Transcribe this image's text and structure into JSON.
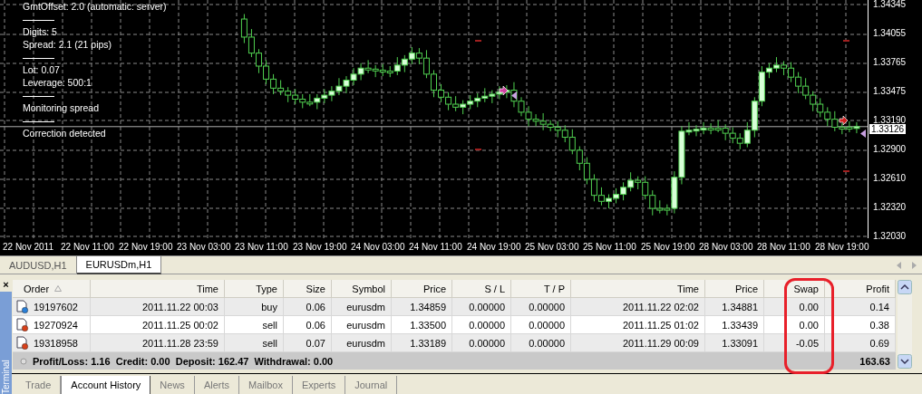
{
  "chart": {
    "info_lines": [
      {
        "kind": "text",
        "text": "GmtOffset: 2.0 (automatic: server)"
      },
      {
        "kind": "rule"
      },
      {
        "kind": "text",
        "text": "Digits:  5"
      },
      {
        "kind": "text",
        "text": "Spread: 2.1 (21 pips)"
      },
      {
        "kind": "rule"
      },
      {
        "kind": "text",
        "text": "Lot: 0.07"
      },
      {
        "kind": "text",
        "text": "Leverage: 500:1"
      },
      {
        "kind": "rule"
      },
      {
        "kind": "text",
        "text": "Monitoring spread"
      },
      {
        "kind": "rule"
      },
      {
        "kind": "text",
        "text": "Correction detected"
      }
    ],
    "current_price": "1.33126",
    "chart_data": {
      "type": "candlestick",
      "ylim": [
        1.3203,
        1.34345
      ],
      "grid": true,
      "ref_lines": [
        {
          "axis": "y",
          "value": 1.33126
        }
      ],
      "yticks": [
        {
          "value": 1.34345,
          "label": "1.34345"
        },
        {
          "value": 1.34055,
          "label": "1.34055"
        },
        {
          "value": 1.33765,
          "label": "1.33765"
        },
        {
          "value": 1.33475,
          "label": "1.33475"
        },
        {
          "value": 1.3319,
          "label": "1.33190"
        },
        {
          "value": 1.329,
          "label": "1.32900"
        },
        {
          "value": 1.3261,
          "label": "1.32610"
        },
        {
          "value": 1.3232,
          "label": "1.32320"
        },
        {
          "value": 1.3203,
          "label": "1.32030"
        }
      ],
      "categories": [
        null,
        null,
        null,
        null,
        null,
        null,
        null,
        null,
        null,
        null,
        null,
        null,
        null,
        null,
        null,
        null,
        null,
        null,
        null,
        null,
        null,
        null,
        null,
        null,
        null,
        null,
        null,
        null,
        null,
        null,
        null,
        null,
        null,
        null,
        null,
        null,
        null,
        null,
        null,
        null,
        null,
        null,
        null,
        null,
        null,
        null,
        null,
        null,
        null,
        null,
        null,
        null,
        null,
        null,
        null,
        null,
        null,
        null,
        null,
        null,
        null,
        null,
        null,
        null,
        null,
        null,
        null,
        null,
        null,
        null,
        null,
        null,
        null,
        null,
        null,
        null,
        null,
        null,
        null,
        null,
        null,
        null,
        null,
        null,
        null,
        null,
        null,
        null,
        null,
        null,
        null,
        null,
        null,
        null,
        null,
        null,
        null,
        null,
        null,
        null,
        null,
        null,
        null,
        null,
        null,
        null,
        null,
        null,
        null,
        null,
        null,
        null,
        null,
        null,
        null,
        null,
        null,
        null,
        null
      ],
      "ohlc": [
        null,
        null,
        null,
        null,
        null,
        null,
        null,
        null,
        null,
        null,
        null,
        null,
        null,
        null,
        null,
        null,
        null,
        null,
        null,
        null,
        null,
        null,
        null,
        null,
        null,
        null,
        null,
        null,
        null,
        null,
        null,
        null,
        null,
        [
          1.342,
          1.3425,
          1.3396,
          1.3402
        ],
        [
          1.3402,
          1.341,
          1.3382,
          1.3386
        ],
        [
          1.3386,
          1.339,
          1.3366,
          1.3373
        ],
        [
          1.3373,
          1.3379,
          1.3355,
          1.336
        ],
        [
          1.336,
          1.3365,
          1.3345,
          1.3351
        ],
        [
          1.3351,
          1.3359,
          1.3344,
          1.3348
        ],
        [
          1.3348,
          1.3352,
          1.3337,
          1.3344
        ],
        [
          1.3344,
          1.335,
          1.3335,
          1.334
        ],
        [
          1.334,
          1.3345,
          1.3331,
          1.3337
        ],
        [
          1.3337,
          1.3345,
          1.3333,
          1.3337
        ],
        [
          1.3337,
          1.3345,
          1.333,
          1.3341
        ],
        [
          1.3341,
          1.335,
          1.3336,
          1.3344
        ],
        [
          1.3344,
          1.3353,
          1.3338,
          1.3348
        ],
        [
          1.3348,
          1.3361,
          1.3344,
          1.3353
        ],
        [
          1.3353,
          1.3363,
          1.3346,
          1.3359
        ],
        [
          1.3359,
          1.3371,
          1.3354,
          1.3365
        ],
        [
          1.3365,
          1.3376,
          1.3359,
          1.3371
        ],
        [
          1.3371,
          1.3379,
          1.3366,
          1.337
        ],
        [
          1.337,
          1.3374,
          1.3362,
          1.3369
        ],
        [
          1.3369,
          1.3375,
          1.3363,
          1.3368
        ],
        [
          1.3368,
          1.3373,
          1.3362,
          1.3368
        ],
        [
          1.3368,
          1.3382,
          1.3364,
          1.3374
        ],
        [
          1.3374,
          1.3384,
          1.3367,
          1.338
        ],
        [
          1.338,
          1.3392,
          1.3375,
          1.3386
        ],
        [
          1.3386,
          1.3391,
          1.3375,
          1.3381
        ],
        [
          1.3381,
          1.3389,
          1.3361,
          1.3365
        ],
        [
          1.3365,
          1.3369,
          1.3342,
          1.3349
        ],
        [
          1.3349,
          1.3355,
          1.3337,
          1.3342
        ],
        [
          1.3342,
          1.3347,
          1.3329,
          1.3335
        ],
        [
          1.3335,
          1.3343,
          1.3328,
          1.3332
        ],
        [
          1.3332,
          1.3339,
          1.3325,
          1.3335
        ],
        [
          1.3335,
          1.3344,
          1.333,
          1.3338
        ],
        [
          1.3338,
          1.3346,
          1.3332,
          1.3341
        ],
        [
          1.3341,
          1.3351,
          1.3337,
          1.3343
        ],
        [
          1.3343,
          1.3349,
          1.3336,
          1.3345
        ],
        [
          1.3345,
          1.3353,
          1.334,
          1.3347
        ],
        [
          1.3347,
          1.3354,
          1.3341,
          1.3349
        ],
        [
          1.3349,
          1.3357,
          1.3332,
          1.3338
        ],
        [
          1.3338,
          1.3342,
          1.3323,
          1.3327
        ],
        [
          1.3327,
          1.3333,
          1.3313,
          1.332
        ],
        [
          1.332,
          1.3325,
          1.3313,
          1.3318
        ],
        [
          1.3318,
          1.3326,
          1.3309,
          1.3315
        ],
        [
          1.3315,
          1.3319,
          1.3308,
          1.3312
        ],
        [
          1.3312,
          1.3318,
          1.3302,
          1.3309
        ],
        [
          1.3309,
          1.3314,
          1.3297,
          1.3302
        ],
        [
          1.3302,
          1.331,
          1.3285,
          1.3289
        ],
        [
          1.3289,
          1.3293,
          1.3269,
          1.3276
        ],
        [
          1.3276,
          1.3282,
          1.3255,
          1.326
        ],
        [
          1.326,
          1.3265,
          1.3238,
          1.3244
        ],
        [
          1.3244,
          1.3252,
          1.3234,
          1.3238
        ],
        [
          1.3238,
          1.3245,
          1.3231,
          1.3241
        ],
        [
          1.3241,
          1.3251,
          1.3236,
          1.3245
        ],
        [
          1.3245,
          1.3257,
          1.3239,
          1.3252
        ],
        [
          1.3252,
          1.3267,
          1.3248,
          1.3259
        ],
        [
          1.3259,
          1.3263,
          1.325,
          1.3257
        ],
        [
          1.3257,
          1.3263,
          1.324,
          1.3244
        ],
        [
          1.3244,
          1.3249,
          1.3224,
          1.3231
        ],
        [
          1.3231,
          1.3239,
          1.3226,
          1.3231
        ],
        [
          1.3231,
          1.3235,
          1.3224,
          1.3231
        ],
        [
          1.3231,
          1.3268,
          1.3226,
          1.3262
        ],
        [
          1.3262,
          1.3313,
          1.3255,
          1.3308
        ],
        [
          1.3308,
          1.3317,
          1.3304,
          1.3309
        ],
        [
          1.3309,
          1.3314,
          1.3303,
          1.331
        ],
        [
          1.331,
          1.3317,
          1.3305,
          1.3311
        ],
        [
          1.3311,
          1.3316,
          1.3305,
          1.3311
        ],
        [
          1.3311,
          1.3319,
          1.3307,
          1.3311
        ],
        [
          1.3311,
          1.3315,
          1.3299,
          1.3306
        ],
        [
          1.3306,
          1.3312,
          1.3296,
          1.3301
        ],
        [
          1.3301,
          1.3306,
          1.329,
          1.3296
        ],
        [
          1.3296,
          1.3317,
          1.3292,
          1.3309
        ],
        [
          1.3309,
          1.3342,
          1.3302,
          1.3338
        ],
        [
          1.3338,
          1.3373,
          1.3333,
          1.3367
        ],
        [
          1.3367,
          1.3376,
          1.3361,
          1.3371
        ],
        [
          1.3371,
          1.3382,
          1.3367,
          1.3374
        ],
        [
          1.3374,
          1.3378,
          1.3364,
          1.3371
        ],
        [
          1.3371,
          1.3377,
          1.3357,
          1.3362
        ],
        [
          1.3362,
          1.3367,
          1.3346,
          1.3353
        ],
        [
          1.3353,
          1.3361,
          1.334,
          1.3344
        ],
        [
          1.3344,
          1.3348,
          1.3328,
          1.3335
        ],
        [
          1.3335,
          1.3341,
          1.3322,
          1.3327
        ],
        [
          1.3327,
          1.3332,
          1.3313,
          1.332
        ],
        [
          1.332,
          1.3328,
          1.3308,
          1.3312
        ],
        [
          1.3312,
          1.3316,
          1.3305,
          1.3312
        ],
        [
          1.3312,
          1.3318,
          1.3307,
          1.3312
        ],
        [
          1.3312,
          1.3317,
          1.3306,
          1.33126
        ],
        null
      ]
    },
    "time_labels": [
      "22 Nov 2011",
      "22 Nov 11:00",
      "22 Nov 19:00",
      "23 Nov 03:00",
      "23 Nov 11:00",
      "23 Nov 19:00",
      "24 Nov 03:00",
      "24 Nov 11:00",
      "24 Nov 19:00",
      "25 Nov 03:00",
      "25 Nov 11:00",
      "25 Nov 19:00",
      "28 Nov 03:00",
      "28 Nov 11:00",
      "28 Nov 19:00"
    ]
  },
  "symbol_tabs": [
    {
      "label": "AUDUSD,H1",
      "selected": false
    },
    {
      "label": "EURUSDm,H1",
      "selected": true
    }
  ],
  "terminal": {
    "title": "Terminal",
    "close": "×",
    "columns": [
      "Order",
      "Time",
      "Type",
      "Size",
      "Symbol",
      "Price",
      "S / L",
      "T / P",
      "Time",
      "Price",
      "Swap",
      "Profit"
    ],
    "rows": [
      {
        "kind": "buy",
        "cells": [
          "19197602",
          "2011.11.22 00:03",
          "buy",
          "0.06",
          "eurusdm",
          "1.34859",
          "0.00000",
          "0.00000",
          "2011.11.22 02:02",
          "1.34881",
          "0.00",
          "0.14"
        ]
      },
      {
        "kind": "sell",
        "cells": [
          "19270924",
          "2011.11.25 00:02",
          "sell",
          "0.06",
          "eurusdm",
          "1.33500",
          "0.00000",
          "0.00000",
          "2011.11.25 01:02",
          "1.33439",
          "0.00",
          "0.38"
        ]
      },
      {
        "kind": "sell",
        "cells": [
          "19318958",
          "2011.11.28 23:59",
          "sell",
          "0.07",
          "eurusdm",
          "1.33189",
          "0.00000",
          "0.00000",
          "2011.11.29 00:09",
          "1.33091",
          "-0.05",
          "0.69"
        ]
      }
    ],
    "summary": {
      "text": "Profit/Loss: 1.16  Credit: 0.00  Deposit: 162.47  Withdrawal: 0.00",
      "total": "163.63"
    },
    "tabs": [
      {
        "label": "Trade",
        "selected": false
      },
      {
        "label": "Account History",
        "selected": true
      },
      {
        "label": "News",
        "selected": false
      },
      {
        "label": "Alerts",
        "selected": false
      },
      {
        "label": "Mailbox",
        "selected": false
      },
      {
        "label": "Experts",
        "selected": false
      },
      {
        "label": "Journal",
        "selected": false
      }
    ]
  }
}
